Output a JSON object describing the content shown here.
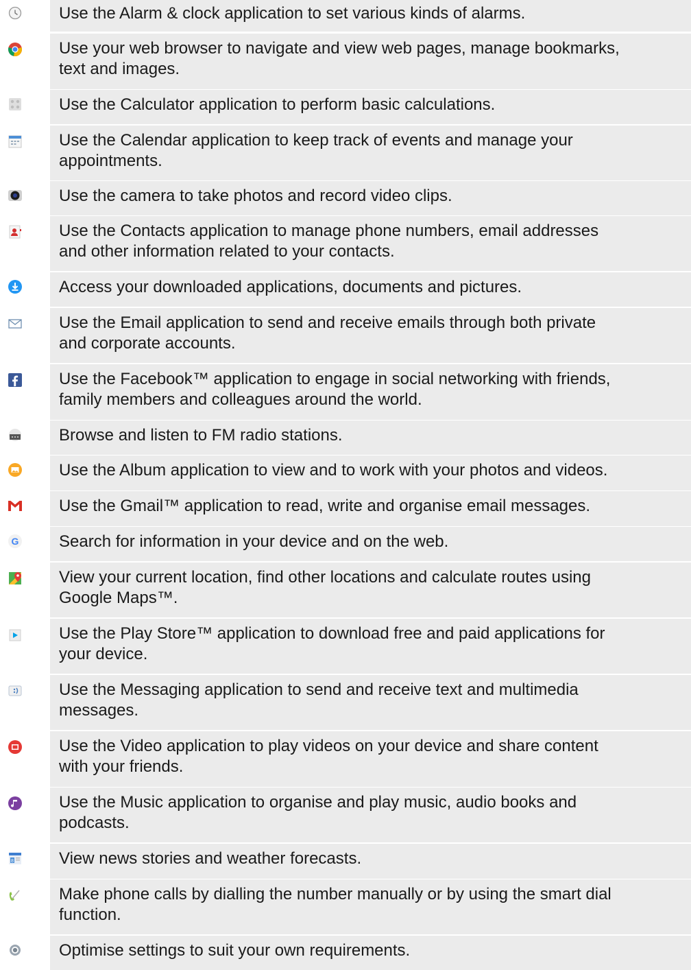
{
  "rows": [
    {
      "icon": "alarm-clock-icon",
      "text": [
        "Use the Alarm & clock application to set various kinds of alarms."
      ]
    },
    {
      "icon": "web-browser-icon",
      "text": [
        "Use your web browser to navigate and view web pages, manage bookmarks,",
        "text and images."
      ]
    },
    {
      "icon": "calculator-icon",
      "text": [
        "Use the Calculator application to perform basic calculations."
      ]
    },
    {
      "icon": "calendar-icon",
      "text": [
        "Use the Calendar application to keep track of events and manage your",
        "appointments."
      ]
    },
    {
      "icon": "camera-icon",
      "text": [
        "Use the camera to take photos and record video clips."
      ]
    },
    {
      "icon": "contacts-icon",
      "text": [
        "Use the Contacts application to manage phone numbers, email addresses",
        "and other information related to your contacts."
      ]
    },
    {
      "icon": "download-icon",
      "text": [
        "Access your downloaded applications, documents and pictures."
      ]
    },
    {
      "icon": "email-envelope-icon",
      "text": [
        "Use the Email application to send and receive emails through both private",
        "and corporate accounts."
      ]
    },
    {
      "icon": "facebook-icon",
      "text": [
        "Use the Facebook™ application to engage in social networking with friends,",
        "family members and colleagues around the world."
      ]
    },
    {
      "icon": "fm-radio-icon",
      "text": [
        "Browse and listen to FM radio stations."
      ]
    },
    {
      "icon": "album-icon",
      "text": [
        "Use the Album application to view and to work with your photos and videos."
      ]
    },
    {
      "icon": "gmail-icon",
      "text": [
        "Use the Gmail™ application to read, write and organise email messages."
      ]
    },
    {
      "icon": "google-search-icon",
      "text": [
        "Search for information in your device and on the web."
      ]
    },
    {
      "icon": "maps-icon",
      "text": [
        "View your current location, find other locations and calculate routes using",
        "Google Maps™."
      ]
    },
    {
      "icon": "play-store-icon",
      "text": [
        "Use the Play Store™ application to download free and paid applications for",
        "your device."
      ]
    },
    {
      "icon": "messaging-icon",
      "text": [
        "Use the Messaging application to send and receive text and multimedia",
        "messages."
      ]
    },
    {
      "icon": "video-icon",
      "text": [
        "Use the Video application to play videos on your device and share content",
        "with your friends."
      ]
    },
    {
      "icon": "music-icon",
      "text": [
        "Use the Music application to organise and play music, audio books and",
        "podcasts."
      ]
    },
    {
      "icon": "news-weather-icon",
      "text": [
        "View news stories and weather forecasts."
      ]
    },
    {
      "icon": "phone-icon",
      "text": [
        "Make phone calls by dialling the number manually or by using the smart dial",
        "function."
      ]
    },
    {
      "icon": "settings-icon",
      "text": [
        "Optimise settings to suit your own requirements."
      ]
    }
  ]
}
